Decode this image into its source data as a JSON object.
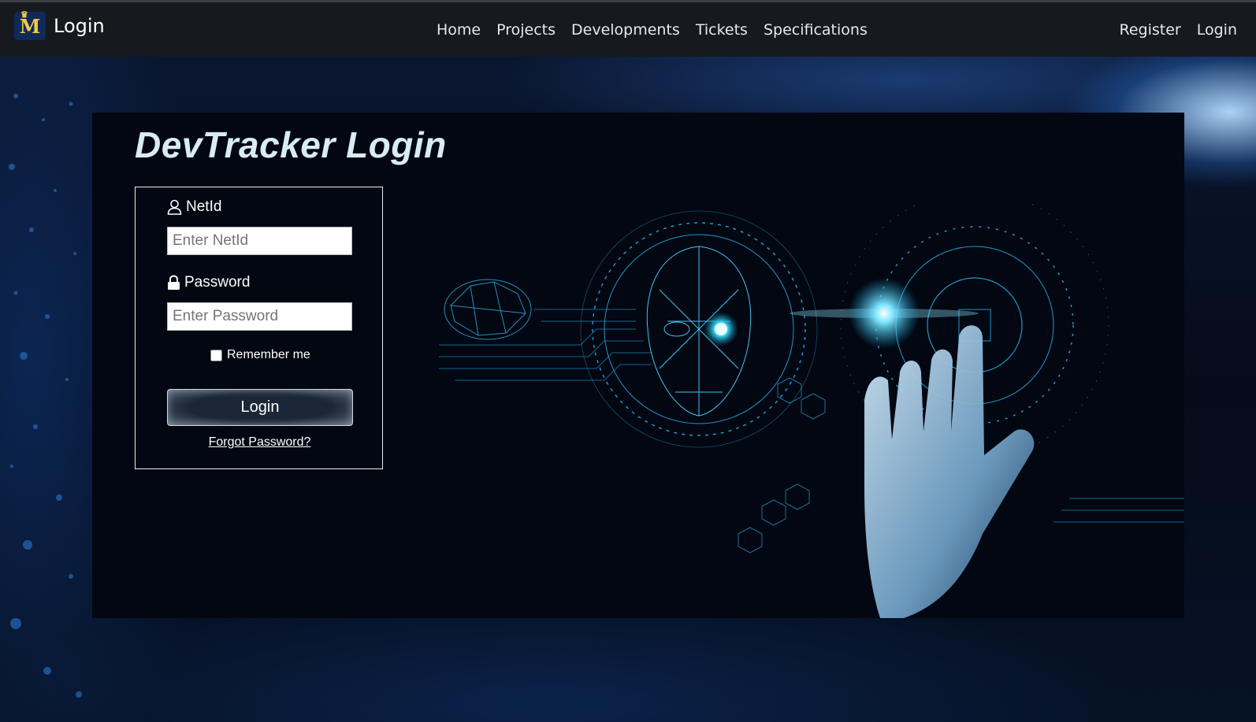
{
  "navbar": {
    "brand_logo_letter": "M",
    "brand_title": "Login",
    "links": [
      "Home",
      "Projects",
      "Developments",
      "Tickets",
      "Specifications"
    ],
    "right_links": [
      "Register",
      "Login"
    ]
  },
  "page": {
    "title": "DevTracker Login"
  },
  "form": {
    "netid_label": "NetId",
    "netid_placeholder": "Enter NetId",
    "netid_value": "",
    "password_label": "Password",
    "password_placeholder": "Enter Password",
    "password_value": "",
    "remember_label": "Remember me",
    "remember_checked": false,
    "login_button": "Login",
    "forgot_link": "Forgot Password?"
  },
  "icons": {
    "netid": "user-icon",
    "password": "lock-icon"
  },
  "colors": {
    "navbar": "#161a1f",
    "panel": "#020712",
    "accent": "#22b7e6"
  }
}
